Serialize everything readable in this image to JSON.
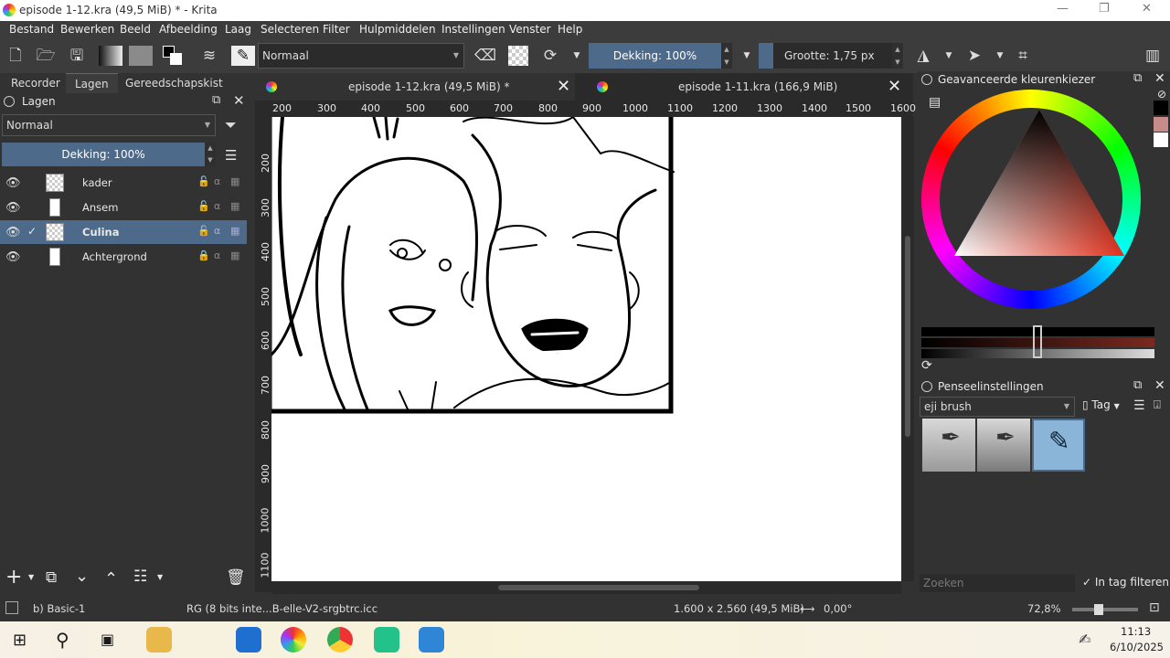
{
  "window": {
    "title": "episode 1-12.kra (49,5 MiB) * - Krita",
    "minimize": "—",
    "restore": "❐",
    "close": "✕"
  },
  "menu": [
    "Bestand",
    "Bewerken",
    "Beeld",
    "Afbeelding",
    "Laag",
    "Selecteren",
    "Filter",
    "Hulpmiddelen",
    "Instellingen",
    "Venster",
    "Help"
  ],
  "toolbar": {
    "blend_mode": "Normaal",
    "opacity": "Dekking: 100%",
    "size": "Grootte: 1,75 px"
  },
  "left_docker": {
    "tabs": [
      "Recorder",
      "Lagen",
      "Gereedschapskist"
    ],
    "panel_title": "Lagen",
    "blend_mode": "Normaal",
    "opacity": "Dekking: 100%",
    "layers": [
      {
        "name": "kader",
        "selected": false
      },
      {
        "name": "Ansem",
        "selected": false
      },
      {
        "name": "Culina",
        "selected": true
      },
      {
        "name": "Achtergrond",
        "selected": false
      }
    ]
  },
  "documents": [
    {
      "title": "episode 1-12.kra (49,5 MiB) *",
      "active": true
    },
    {
      "title": "episode 1-11.kra (166,9 MiB)",
      "active": false
    }
  ],
  "ruler": {
    "h": [
      "200",
      "300",
      "400",
      "500",
      "600",
      "700",
      "800",
      "900",
      "1000",
      "1100",
      "1200",
      "1300",
      "1400",
      "1500",
      "1600"
    ],
    "v": [
      "200",
      "300",
      "400",
      "500",
      "600",
      "700",
      "800",
      "900",
      "1000",
      "1100"
    ]
  },
  "color_docker": {
    "title": "Geavanceerde kleurenkiezer"
  },
  "brush_docker": {
    "title": "Penseelinstellingen",
    "tag_value": "eji brush",
    "tag_label": "Tag",
    "search_placeholder": "Zoeken",
    "filter_label": "In tag filteren"
  },
  "status": {
    "preset": "b) Basic-1",
    "colorspace": "RG  (8 bits inte...B-elle-V2-srgbtrc.icc",
    "dimensions": "1.600 x 2.560 (49,5 MiB)",
    "rotation": "0,00°",
    "zoom": "72,8%"
  },
  "taskbar": {
    "time": "11:13",
    "date": "6/10/2025"
  }
}
